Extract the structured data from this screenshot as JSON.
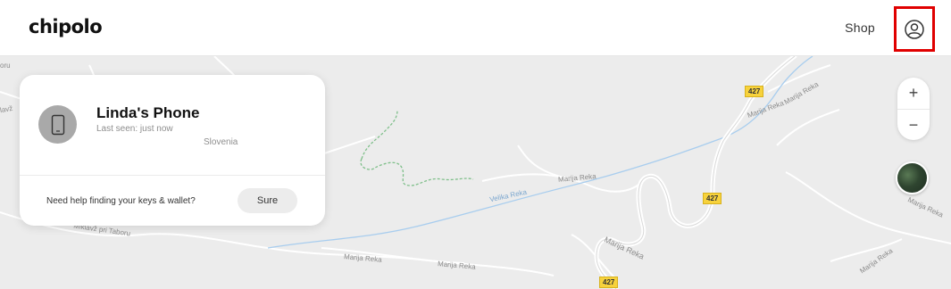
{
  "header": {
    "logo": "chipolo",
    "shop_label": "Shop",
    "account_icon": "user-circle-icon"
  },
  "device_card": {
    "name": "Linda's Phone",
    "last_seen": "Last seen: just now",
    "location": "Slovenia",
    "device_icon": "phone-icon",
    "help_text": "Need help finding your keys & wallet?",
    "help_button": "Sure"
  },
  "map": {
    "zoom_in": "+",
    "zoom_out": "−",
    "satellite_toggle": "satellite-thumbnail",
    "labels": {
      "river": "Velika Reka",
      "marija_reka_1": "Marija Reka",
      "marija_reka_2": "Marija Reka",
      "marija_reka_3": "Marija Reka",
      "marija_reka_4": "Marija Reka",
      "marija_reka_5": "Marija Reka",
      "marija_reka_6": "Marija Reka",
      "marija_reka_7": "Marija Reka",
      "marija_reka_8": "Marija Reka",
      "miklavz": "Miklavž pri Taboru",
      "left_edge": "lavž",
      "left_edge_2": "oru"
    },
    "road_numbers": [
      "427",
      "427",
      "427"
    ]
  },
  "colors": {
    "accent_highlight": "#e00000",
    "map_background": "#ececec",
    "river": "#a8cdee",
    "road_badge": "#f7d23c"
  }
}
